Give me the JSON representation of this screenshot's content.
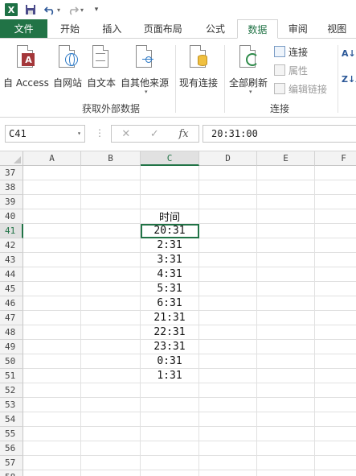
{
  "qat": {
    "excel_logo": "X",
    "icons": [
      "save-icon",
      "undo-icon",
      "redo-icon",
      "customize-icon"
    ]
  },
  "tabs": [
    {
      "label": "文件",
      "kind": "file"
    },
    {
      "label": "开始"
    },
    {
      "label": "插入"
    },
    {
      "label": "页面布局"
    },
    {
      "label": "公式"
    },
    {
      "label": "数据",
      "active": true
    },
    {
      "label": "审阅"
    },
    {
      "label": "视图"
    }
  ],
  "ribbon": {
    "from_access": "自 Access",
    "from_web": "自网站",
    "from_text": "自文本",
    "from_other": "自其他来源",
    "existing_conn": "现有连接",
    "group_external": "获取外部数据",
    "refresh_all": "全部刷新",
    "connections": "连接",
    "properties": "属性",
    "edit_links": "编辑链接",
    "group_connections": "连接",
    "sort_az": "A↓Z",
    "sort_za": "Z↓A"
  },
  "formula_bar": {
    "name_box": "C41",
    "cancel": "✕",
    "enter": "✓",
    "fx": "fx",
    "content": "20:31:00"
  },
  "grid": {
    "columns": [
      "A",
      "B",
      "C",
      "D",
      "E",
      "F"
    ],
    "selected_column": "C",
    "active_cell": "C41",
    "rows": [
      {
        "num": "37",
        "c": ""
      },
      {
        "num": "38",
        "c": ""
      },
      {
        "num": "39",
        "c": ""
      },
      {
        "num": "40",
        "c": "时间"
      },
      {
        "num": "41",
        "c": "20:31"
      },
      {
        "num": "42",
        "c": "2:31"
      },
      {
        "num": "43",
        "c": "3:31"
      },
      {
        "num": "44",
        "c": "4:31"
      },
      {
        "num": "45",
        "c": "5:31"
      },
      {
        "num": "46",
        "c": "6:31"
      },
      {
        "num": "47",
        "c": "21:31"
      },
      {
        "num": "48",
        "c": "22:31"
      },
      {
        "num": "49",
        "c": "23:31"
      },
      {
        "num": "50",
        "c": "0:31"
      },
      {
        "num": "51",
        "c": "1:31"
      },
      {
        "num": "52",
        "c": ""
      },
      {
        "num": "53",
        "c": ""
      },
      {
        "num": "54",
        "c": ""
      },
      {
        "num": "55",
        "c": ""
      },
      {
        "num": "56",
        "c": ""
      },
      {
        "num": "57",
        "c": ""
      },
      {
        "num": "58",
        "c": ""
      }
    ]
  }
}
